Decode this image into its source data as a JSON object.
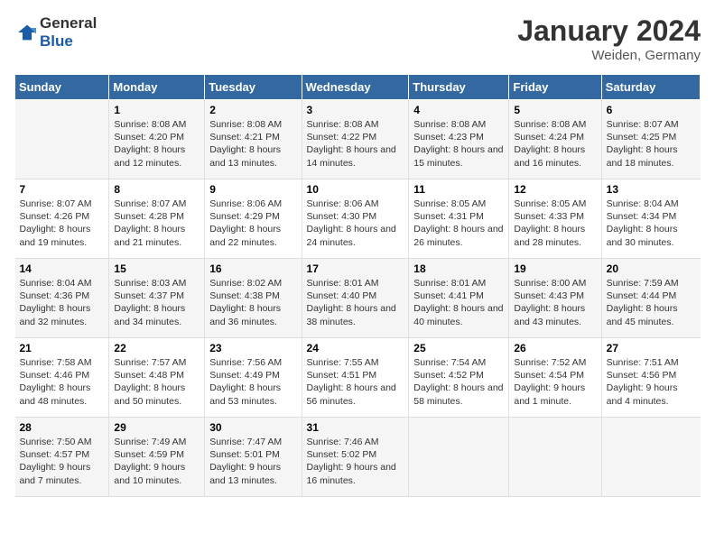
{
  "logo": {
    "general": "General",
    "blue": "Blue"
  },
  "title": "January 2024",
  "location": "Weiden, Germany",
  "days_of_week": [
    "Sunday",
    "Monday",
    "Tuesday",
    "Wednesday",
    "Thursday",
    "Friday",
    "Saturday"
  ],
  "weeks": [
    [
      {
        "day": "",
        "sunrise": "",
        "sunset": "",
        "daylight": ""
      },
      {
        "day": "1",
        "sunrise": "Sunrise: 8:08 AM",
        "sunset": "Sunset: 4:20 PM",
        "daylight": "Daylight: 8 hours and 12 minutes."
      },
      {
        "day": "2",
        "sunrise": "Sunrise: 8:08 AM",
        "sunset": "Sunset: 4:21 PM",
        "daylight": "Daylight: 8 hours and 13 minutes."
      },
      {
        "day": "3",
        "sunrise": "Sunrise: 8:08 AM",
        "sunset": "Sunset: 4:22 PM",
        "daylight": "Daylight: 8 hours and 14 minutes."
      },
      {
        "day": "4",
        "sunrise": "Sunrise: 8:08 AM",
        "sunset": "Sunset: 4:23 PM",
        "daylight": "Daylight: 8 hours and 15 minutes."
      },
      {
        "day": "5",
        "sunrise": "Sunrise: 8:08 AM",
        "sunset": "Sunset: 4:24 PM",
        "daylight": "Daylight: 8 hours and 16 minutes."
      },
      {
        "day": "6",
        "sunrise": "Sunrise: 8:07 AM",
        "sunset": "Sunset: 4:25 PM",
        "daylight": "Daylight: 8 hours and 18 minutes."
      }
    ],
    [
      {
        "day": "7",
        "sunrise": "Sunrise: 8:07 AM",
        "sunset": "Sunset: 4:26 PM",
        "daylight": "Daylight: 8 hours and 19 minutes."
      },
      {
        "day": "8",
        "sunrise": "Sunrise: 8:07 AM",
        "sunset": "Sunset: 4:28 PM",
        "daylight": "Daylight: 8 hours and 21 minutes."
      },
      {
        "day": "9",
        "sunrise": "Sunrise: 8:06 AM",
        "sunset": "Sunset: 4:29 PM",
        "daylight": "Daylight: 8 hours and 22 minutes."
      },
      {
        "day": "10",
        "sunrise": "Sunrise: 8:06 AM",
        "sunset": "Sunset: 4:30 PM",
        "daylight": "Daylight: 8 hours and 24 minutes."
      },
      {
        "day": "11",
        "sunrise": "Sunrise: 8:05 AM",
        "sunset": "Sunset: 4:31 PM",
        "daylight": "Daylight: 8 hours and 26 minutes."
      },
      {
        "day": "12",
        "sunrise": "Sunrise: 8:05 AM",
        "sunset": "Sunset: 4:33 PM",
        "daylight": "Daylight: 8 hours and 28 minutes."
      },
      {
        "day": "13",
        "sunrise": "Sunrise: 8:04 AM",
        "sunset": "Sunset: 4:34 PM",
        "daylight": "Daylight: 8 hours and 30 minutes."
      }
    ],
    [
      {
        "day": "14",
        "sunrise": "Sunrise: 8:04 AM",
        "sunset": "Sunset: 4:36 PM",
        "daylight": "Daylight: 8 hours and 32 minutes."
      },
      {
        "day": "15",
        "sunrise": "Sunrise: 8:03 AM",
        "sunset": "Sunset: 4:37 PM",
        "daylight": "Daylight: 8 hours and 34 minutes."
      },
      {
        "day": "16",
        "sunrise": "Sunrise: 8:02 AM",
        "sunset": "Sunset: 4:38 PM",
        "daylight": "Daylight: 8 hours and 36 minutes."
      },
      {
        "day": "17",
        "sunrise": "Sunrise: 8:01 AM",
        "sunset": "Sunset: 4:40 PM",
        "daylight": "Daylight: 8 hours and 38 minutes."
      },
      {
        "day": "18",
        "sunrise": "Sunrise: 8:01 AM",
        "sunset": "Sunset: 4:41 PM",
        "daylight": "Daylight: 8 hours and 40 minutes."
      },
      {
        "day": "19",
        "sunrise": "Sunrise: 8:00 AM",
        "sunset": "Sunset: 4:43 PM",
        "daylight": "Daylight: 8 hours and 43 minutes."
      },
      {
        "day": "20",
        "sunrise": "Sunrise: 7:59 AM",
        "sunset": "Sunset: 4:44 PM",
        "daylight": "Daylight: 8 hours and 45 minutes."
      }
    ],
    [
      {
        "day": "21",
        "sunrise": "Sunrise: 7:58 AM",
        "sunset": "Sunset: 4:46 PM",
        "daylight": "Daylight: 8 hours and 48 minutes."
      },
      {
        "day": "22",
        "sunrise": "Sunrise: 7:57 AM",
        "sunset": "Sunset: 4:48 PM",
        "daylight": "Daylight: 8 hours and 50 minutes."
      },
      {
        "day": "23",
        "sunrise": "Sunrise: 7:56 AM",
        "sunset": "Sunset: 4:49 PM",
        "daylight": "Daylight: 8 hours and 53 minutes."
      },
      {
        "day": "24",
        "sunrise": "Sunrise: 7:55 AM",
        "sunset": "Sunset: 4:51 PM",
        "daylight": "Daylight: 8 hours and 56 minutes."
      },
      {
        "day": "25",
        "sunrise": "Sunrise: 7:54 AM",
        "sunset": "Sunset: 4:52 PM",
        "daylight": "Daylight: 8 hours and 58 minutes."
      },
      {
        "day": "26",
        "sunrise": "Sunrise: 7:52 AM",
        "sunset": "Sunset: 4:54 PM",
        "daylight": "Daylight: 9 hours and 1 minute."
      },
      {
        "day": "27",
        "sunrise": "Sunrise: 7:51 AM",
        "sunset": "Sunset: 4:56 PM",
        "daylight": "Daylight: 9 hours and 4 minutes."
      }
    ],
    [
      {
        "day": "28",
        "sunrise": "Sunrise: 7:50 AM",
        "sunset": "Sunset: 4:57 PM",
        "daylight": "Daylight: 9 hours and 7 minutes."
      },
      {
        "day": "29",
        "sunrise": "Sunrise: 7:49 AM",
        "sunset": "Sunset: 4:59 PM",
        "daylight": "Daylight: 9 hours and 10 minutes."
      },
      {
        "day": "30",
        "sunrise": "Sunrise: 7:47 AM",
        "sunset": "Sunset: 5:01 PM",
        "daylight": "Daylight: 9 hours and 13 minutes."
      },
      {
        "day": "31",
        "sunrise": "Sunrise: 7:46 AM",
        "sunset": "Sunset: 5:02 PM",
        "daylight": "Daylight: 9 hours and 16 minutes."
      },
      {
        "day": "",
        "sunrise": "",
        "sunset": "",
        "daylight": ""
      },
      {
        "day": "",
        "sunrise": "",
        "sunset": "",
        "daylight": ""
      },
      {
        "day": "",
        "sunrise": "",
        "sunset": "",
        "daylight": ""
      }
    ]
  ]
}
